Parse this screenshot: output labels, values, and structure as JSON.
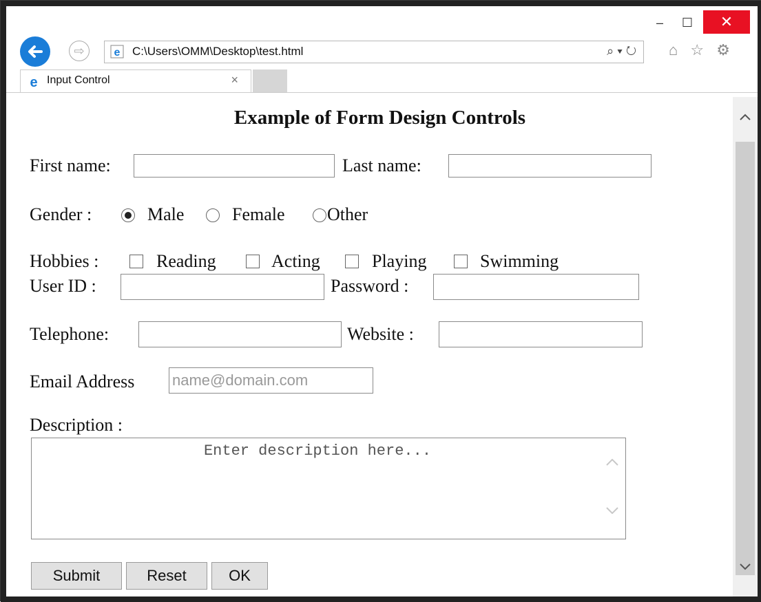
{
  "browser": {
    "url": "C:\\Users\\OMM\\Desktop\\test.html",
    "tab_title": "Input Control",
    "tab_close": "×",
    "min_glyph": "–",
    "max_glyph": "☐",
    "close_glyph": "✕",
    "back_glyph": "←",
    "fwd_glyph": "⇨",
    "addr_tools": "⌕ ▾ ↻",
    "toolicons": "⌂ ☆ ⚙",
    "colors": {
      "back_button": "#1a7dd8",
      "close_button": "#e81123"
    }
  },
  "form": {
    "title": "Example of Form Design Controls",
    "first_name_label": "First name:",
    "last_name_label": "Last name:",
    "gender_label": "Gender :",
    "gender_options": [
      "Male",
      "Female",
      "Other"
    ],
    "gender_selected": "Male",
    "hobbies_label": "Hobbies :",
    "hobbies": [
      "Reading",
      "Acting",
      "Playing",
      "Swimming"
    ],
    "user_id_label": "User ID :",
    "password_label": "Password :",
    "telephone_label": "Telephone:",
    "website_label": "Website :",
    "email_label": "Email Address",
    "email_placeholder": "name@domain.com",
    "description_label": "Description :",
    "description_placeholder": "Enter description here...",
    "buttons": {
      "submit": "Submit",
      "reset": "Reset",
      "ok": "OK"
    }
  }
}
